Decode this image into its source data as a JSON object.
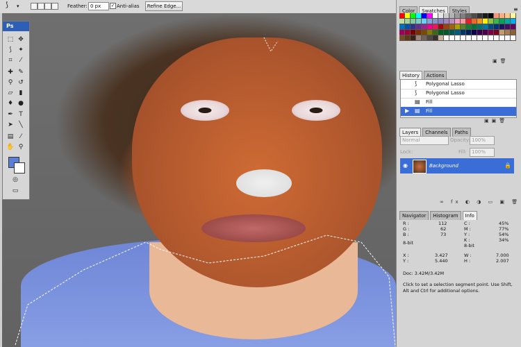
{
  "options_bar": {
    "feather_label": "Feather:",
    "feather_value": "0 px",
    "anti_alias_label": "Anti-alias",
    "anti_alias_checked": true,
    "refine_edge_label": "Refine Edge..."
  },
  "tools": {
    "logo": "Ps",
    "foreground_color": "#5b7fd6",
    "background_color": "#ffffff"
  },
  "swatch_panel": {
    "tabs": [
      "Color",
      "Swatches",
      "Styles"
    ],
    "active_tab": "Swatches"
  },
  "history_panel": {
    "tabs": [
      "History",
      "Actions"
    ],
    "items": [
      "Polygonal Lasso",
      "Polygonal Lasso",
      "Fill",
      "Fill"
    ],
    "selected_index": 3
  },
  "layers_panel": {
    "tabs": [
      "Layers",
      "Channels",
      "Paths"
    ],
    "blend_mode": "Normal",
    "opacity_label": "Opacity:",
    "opacity_value": "100%",
    "lock_label": "Lock:",
    "fill_label": "Fill:",
    "fill_value": "100%",
    "layer_name": "Background"
  },
  "info_panel": {
    "tabs": [
      "Navigator",
      "Histogram",
      "Info"
    ],
    "active_tab": "Info",
    "r_label": "R :",
    "r_value": "112",
    "g_label": "G :",
    "g_value": "62",
    "b_label": "B :",
    "b_value": "73",
    "c_label": "C :",
    "c_value": "45%",
    "m_label": "M :",
    "m_value": "77%",
    "y_label": "Y :",
    "y_value": "54%",
    "k_label": "K :",
    "k_value": "34%",
    "bit_left": "8-bit",
    "bit_right": "8-bit",
    "x_label": "X :",
    "x_value": "3.427",
    "yy_label": "Y :",
    "yy_value": "5.440",
    "w_label": "W :",
    "w_value": "7.000",
    "h_label": "H :",
    "h_value": "2.007",
    "doc": "Doc: 3.42M/3.42M",
    "hint": "Click to set a selection segment point. Use Shift, Alt and Ctrl for additional options."
  }
}
